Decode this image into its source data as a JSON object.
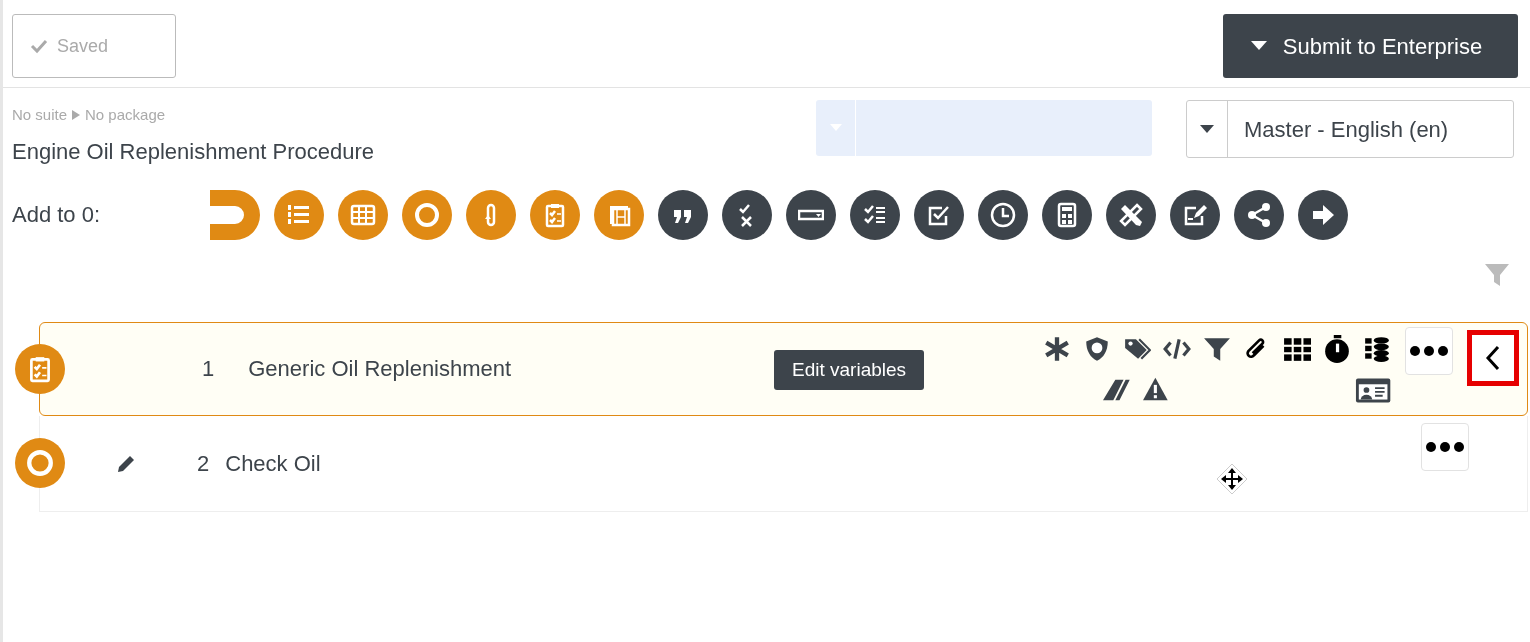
{
  "toolbar": {
    "saved_label": "Saved",
    "submit_label": "Submit to Enterprise"
  },
  "breadcrumb": {
    "suite": "No suite",
    "package": "No package"
  },
  "procedure_title": "Engine Oil Replenishment Procedure",
  "language": {
    "value": "Master - English (en)"
  },
  "palette": {
    "label": "Add to 0:",
    "items": [
      {
        "kind": "partial",
        "color": "#e08a14"
      },
      {
        "kind": "numbered-list",
        "color": "#e08a14"
      },
      {
        "kind": "table",
        "color": "#e08a14"
      },
      {
        "kind": "ring",
        "color": "#e08a14"
      },
      {
        "kind": "loop",
        "color": "#e08a14"
      },
      {
        "kind": "clipboard",
        "color": "#e08a14"
      },
      {
        "kind": "film",
        "color": "#e08a14"
      },
      {
        "kind": "quote",
        "color": "#3d444b"
      },
      {
        "kind": "check-cross",
        "color": "#3d444b"
      },
      {
        "kind": "dropdown",
        "color": "#3d444b"
      },
      {
        "kind": "checklist",
        "color": "#3d444b"
      },
      {
        "kind": "checkbox",
        "color": "#3d444b"
      },
      {
        "kind": "clock",
        "color": "#3d444b"
      },
      {
        "kind": "calculator",
        "color": "#3d444b"
      },
      {
        "kind": "pencil-ruler",
        "color": "#3d444b"
      },
      {
        "kind": "sign",
        "color": "#3d444b"
      },
      {
        "kind": "share",
        "color": "#3d444b"
      },
      {
        "kind": "arrow",
        "color": "#3d444b"
      }
    ]
  },
  "steps": [
    {
      "number": "1",
      "title": "Generic Oil Replenishment",
      "kind": "clipboard",
      "selected": true,
      "tooltip": "Edit variables"
    },
    {
      "number": "2",
      "title": "Check Oil",
      "kind": "ring",
      "selected": false
    }
  ]
}
